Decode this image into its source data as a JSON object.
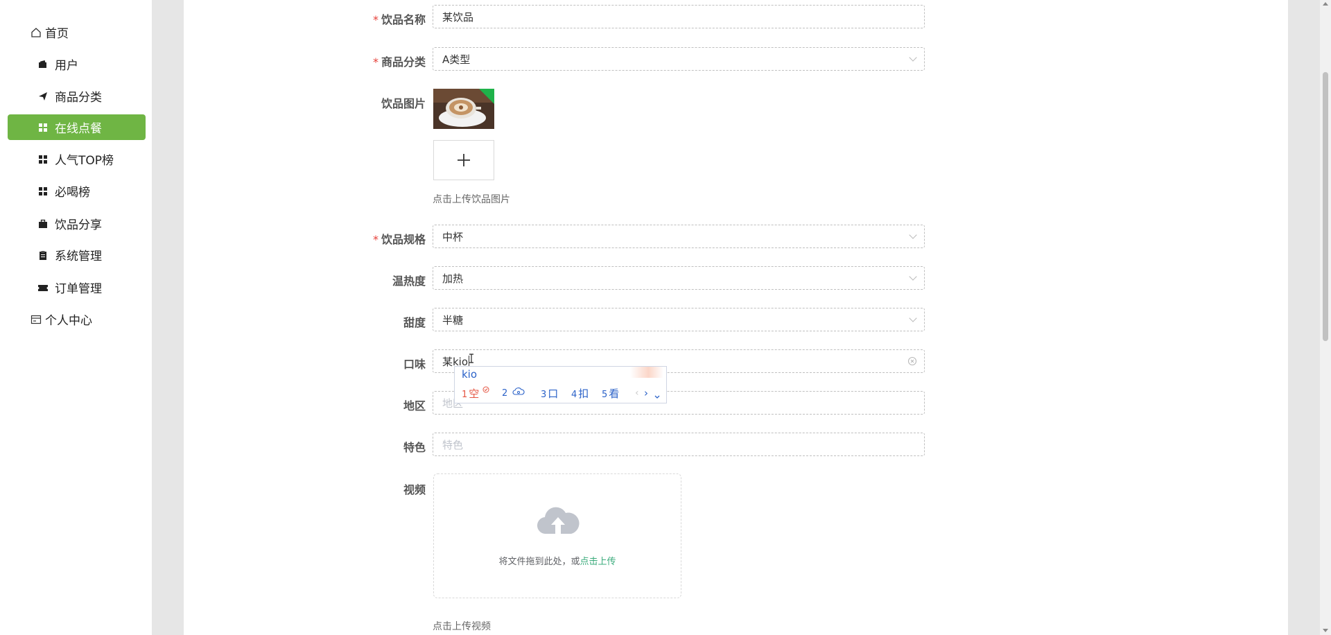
{
  "sidebar": {
    "items": [
      {
        "label": "首页",
        "icon": "home-icon"
      },
      {
        "label": "用户",
        "icon": "wallet-icon"
      },
      {
        "label": "商品分类",
        "icon": "paper-plane-icon"
      },
      {
        "label": "在线点餐",
        "icon": "grid-icon",
        "active": true
      },
      {
        "label": "人气TOP榜",
        "icon": "grid-icon"
      },
      {
        "label": "必喝榜",
        "icon": "grid-icon"
      },
      {
        "label": "饮品分享",
        "icon": "briefcase-icon"
      },
      {
        "label": "系统管理",
        "icon": "clipboard-icon"
      },
      {
        "label": "订单管理",
        "icon": "ticket-icon"
      },
      {
        "label": "个人中心",
        "icon": "card-icon"
      }
    ]
  },
  "colors": {
    "accent": "#6fb544",
    "required": "#e6413a",
    "link": "#3aab7b"
  },
  "form": {
    "name": {
      "label": "饮品名称",
      "value": "某饮品",
      "required": true
    },
    "category": {
      "label": "商品分类",
      "value": "A类型",
      "required": true
    },
    "image": {
      "label": "饮品图片",
      "upload_icon": "plus-icon",
      "hint": "点击上传饮品图片"
    },
    "spec": {
      "label": "饮品规格",
      "value": "中杯",
      "required": true
    },
    "temperature": {
      "label": "温热度",
      "value": "加热"
    },
    "sweetness": {
      "label": "甜度",
      "value": "半糖"
    },
    "taste": {
      "label": "口味",
      "value": "某kio"
    },
    "region": {
      "label": "地区",
      "placeholder": "地区"
    },
    "feature": {
      "label": "特色",
      "placeholder": "特色"
    },
    "video": {
      "label": "视频",
      "drop_text": "将文件拖到此处，或",
      "drop_link": "点击上传",
      "hint": "点击上传视频"
    }
  },
  "ime": {
    "composition": "kio",
    "candidates": [
      {
        "num": "1",
        "text": "空"
      },
      {
        "num": "2",
        "text": ""
      },
      {
        "num": "3",
        "text": "口"
      },
      {
        "num": "4",
        "text": "扣"
      },
      {
        "num": "5",
        "text": "看"
      }
    ]
  }
}
